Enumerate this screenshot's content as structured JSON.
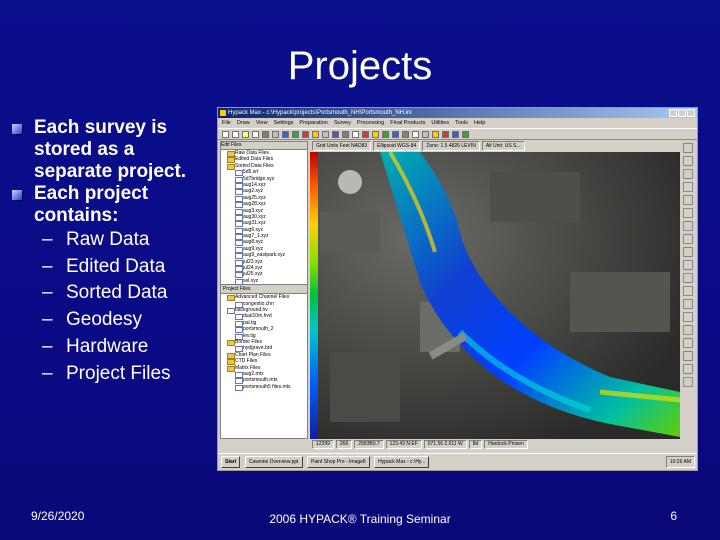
{
  "slide": {
    "title": "Projects",
    "bullets": [
      {
        "text": "Each survey is stored as a separate project."
      },
      {
        "text": "Each project contains:"
      }
    ],
    "sub_items": [
      "Raw Data",
      "Edited Data",
      "Sorted Data",
      "Geodesy",
      "Hardware",
      "Project Files"
    ],
    "dash": "–"
  },
  "footer": {
    "date": "9/26/2020",
    "center": "2006 HYPACK® Training Seminar",
    "page_number": "6"
  },
  "screenshot": {
    "window_title": "Hypack Max - c:\\Hypack\\projects\\Portsmouth_NH\\Portsmouth_NH.ini",
    "menu": [
      "File",
      "Draw",
      "View",
      "Settings",
      "Preparation",
      "Survey",
      "Processing",
      "Final Products",
      "Utilities",
      "Tools",
      "Help"
    ],
    "tree_header": "Edit Files",
    "tree_items": [
      {
        "label": "Raw Data Files",
        "kind": "folder",
        "indent": false
      },
      {
        "label": "Edited Data Files",
        "kind": "folder",
        "indent": false
      },
      {
        "label": "Sorted Data Files",
        "kind": "folder",
        "indent": false
      },
      {
        "label": "5d5.srt",
        "kind": "file",
        "indent": true
      },
      {
        "label": "5d7bridge.xyz",
        "kind": "file",
        "indent": true
      },
      {
        "label": "aug14.xyz",
        "kind": "file",
        "indent": true
      },
      {
        "label": "aug2.xyz",
        "kind": "file",
        "indent": true
      },
      {
        "label": "aug25.xyz",
        "kind": "file",
        "indent": true
      },
      {
        "label": "aug28.xyz",
        "kind": "file",
        "indent": true
      },
      {
        "label": "aug3.xyz",
        "kind": "file",
        "indent": true
      },
      {
        "label": "aug30.xyz",
        "kind": "file",
        "indent": true
      },
      {
        "label": "aug31.xyz",
        "kind": "file",
        "indent": true
      },
      {
        "label": "aug6.xyz",
        "kind": "file",
        "indent": true
      },
      {
        "label": "aug7_1.xyz",
        "kind": "file",
        "indent": true
      },
      {
        "label": "aug8.xyz",
        "kind": "file",
        "indent": true
      },
      {
        "label": "aug9.xyz",
        "kind": "file",
        "indent": true
      },
      {
        "label": "aug9_eastpark.xyz",
        "kind": "file",
        "indent": true
      },
      {
        "label": "jul23.xyz",
        "kind": "file",
        "indent": true
      },
      {
        "label": "jul24.xyz",
        "kind": "file",
        "indent": true
      },
      {
        "label": "jul25.xyz",
        "kind": "file",
        "indent": true
      },
      {
        "label": "sel.xyz",
        "kind": "file",
        "indent": true
      }
    ],
    "project_files_label": "Project Files",
    "project_items": [
      {
        "label": "Advanced Channel Files",
        "kind": "folder",
        "indent": false
      },
      {
        "label": "congestio.chn",
        "kind": "file",
        "indent": true
      },
      {
        "label": "background.hv",
        "kind": "file",
        "indent": false
      },
      {
        "label": "dual10m.hvd",
        "kind": "file",
        "indent": true
      },
      {
        "label": "pal.tig",
        "kind": "file",
        "indent": true
      },
      {
        "label": "portsmouth_2",
        "kind": "file",
        "indent": true
      },
      {
        "label": "lev.tig",
        "kind": "file",
        "indent": true
      },
      {
        "label": "Border Files",
        "kind": "folder",
        "indent": false
      },
      {
        "label": "hydgrave.brd",
        "kind": "file",
        "indent": true
      },
      {
        "label": "Chart Plan Files",
        "kind": "folder",
        "indent": false
      },
      {
        "label": "CTD Files",
        "kind": "folder",
        "indent": false
      },
      {
        "label": "Matrix Files",
        "kind": "folder",
        "indent": false
      },
      {
        "label": "aug2.mtx",
        "kind": "file",
        "indent": true
      },
      {
        "label": "portsmouth.mtx",
        "kind": "file",
        "indent": true
      },
      {
        "label": "portsmouth5 files.mtx",
        "kind": "file",
        "indent": true
      }
    ],
    "map_header": [
      "Grid Units Feet NAD83",
      "Ellipsoid WGS-84",
      "Zone: 1.5 4826 LEVIN",
      "Alt Unit: US S..."
    ],
    "status_fields": [
      "12299",
      "266",
      "2993B0.7",
      "123.43 N EF",
      "071.56 2.011 W",
      "8d",
      "Hardock Pmsen"
    ],
    "taskbar_items": [
      "Start",
      "Cawnine Overview.ppt",
      "Paint Shop Pro - Image8",
      "Hypack Max - c:\\Hy..."
    ],
    "clock": "10:26 AM",
    "colors": {
      "slide_bg": "#0a0f8c",
      "water_shallow": "#ff5a00",
      "water_mid": "#00c8c8",
      "water_deep": "#1020a0"
    }
  }
}
